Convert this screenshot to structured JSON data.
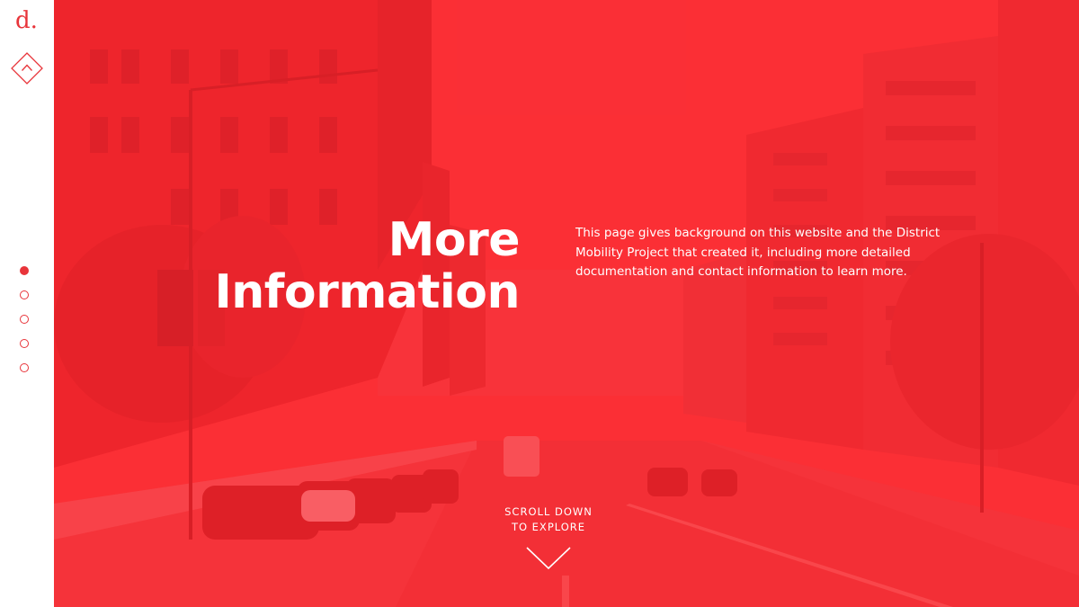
{
  "brand": {
    "logo_text": "d.",
    "accent_color": "#e8343a",
    "home_icon": "diamond-chevron-up-icon"
  },
  "section_nav": {
    "active_index": 0,
    "count": 5
  },
  "hero": {
    "title_line1": "More",
    "title_line2": "Information",
    "description": "This page gives background on this website and the District Mobility Project that created it, including more detailed documentation and contact information to learn more.",
    "scroll_line1": "SCROLL DOWN",
    "scroll_line2": "TO EXPLORE",
    "scroll_icon": "chevron-down-icon",
    "overlay_color": "#ff2832"
  }
}
